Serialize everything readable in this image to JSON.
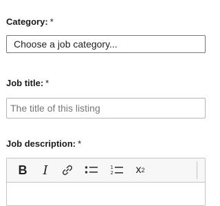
{
  "category": {
    "label": "Category:",
    "required_mark": "*",
    "selected": "Choose a job category..."
  },
  "job_title": {
    "label": "Job title:",
    "required_mark": "*",
    "placeholder": "The title of this listing"
  },
  "job_description": {
    "label": "Job description:",
    "required_mark": "*",
    "toolbar": [
      {
        "icon": "bold-icon",
        "glyph": "B"
      },
      {
        "icon": "italic-icon",
        "glyph": "I"
      },
      {
        "icon": "link-icon"
      },
      {
        "icon": "bullet-list-icon"
      },
      {
        "icon": "numbered-list-icon"
      },
      {
        "icon": "superscript-icon",
        "glyph": "x",
        "sup": "2"
      }
    ]
  }
}
